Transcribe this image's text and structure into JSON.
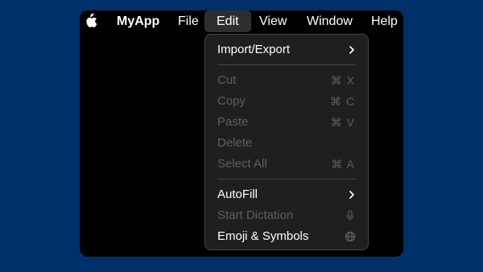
{
  "menubar": {
    "app_name": "MyApp",
    "menus": [
      "File",
      "Edit",
      "View",
      "Window",
      "Help"
    ]
  },
  "edit_menu": {
    "import_export": "Import/Export",
    "cut": {
      "label": "Cut",
      "shortcut": "⌘ X"
    },
    "copy": {
      "label": "Copy",
      "shortcut": "⌘ C"
    },
    "paste": {
      "label": "Paste",
      "shortcut": "⌘ V"
    },
    "delete": "Delete",
    "select_all": {
      "label": "Select All",
      "shortcut": "⌘ A"
    },
    "autofill": "AutoFill",
    "start_dictation": "Start Dictation",
    "emoji_symbols": "Emoji & Symbols"
  },
  "colors": {
    "background": "#00306a",
    "window": "#000000",
    "menu": "#1f1f1f",
    "disabled_text": "#5f5f5f"
  }
}
